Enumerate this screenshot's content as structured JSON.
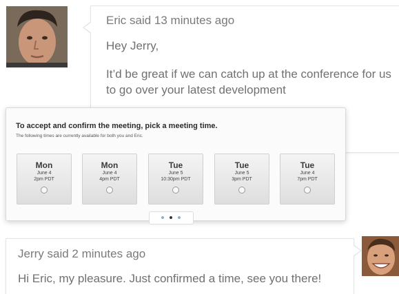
{
  "eric_message": {
    "author_line": "Eric said 13 minutes ago",
    "greeting": "Hey Jerry,",
    "body": "It’d be great if we can catch up at the conference for us to go over your latest development"
  },
  "meeting": {
    "title": "To accept and confirm the meeting, pick a meeting time.",
    "subtitle": "The following times are currently available for both you and Eric.",
    "slots": [
      {
        "day": "Mon",
        "date": "June 4",
        "time": "2pm PDT"
      },
      {
        "day": "Mon",
        "date": "June 4",
        "time": "4pm PDT"
      },
      {
        "day": "Tue",
        "date": "June 5",
        "time": "10:30pm PDT"
      },
      {
        "day": "Tue",
        "date": "June 5",
        "time": "3pm PDT"
      },
      {
        "day": "Tue",
        "date": "June 4",
        "time": "7pm PDT"
      }
    ],
    "pager": {
      "pages": 3,
      "active": 2
    }
  },
  "jerry_message": {
    "author_line": "Jerry said 2 minutes ago",
    "body": "Hi Eric, my pleasure. Just confirmed a time, see you there!"
  },
  "colors": {
    "pager_active": "#333333",
    "pager_inactive": "#7fb3d8"
  }
}
